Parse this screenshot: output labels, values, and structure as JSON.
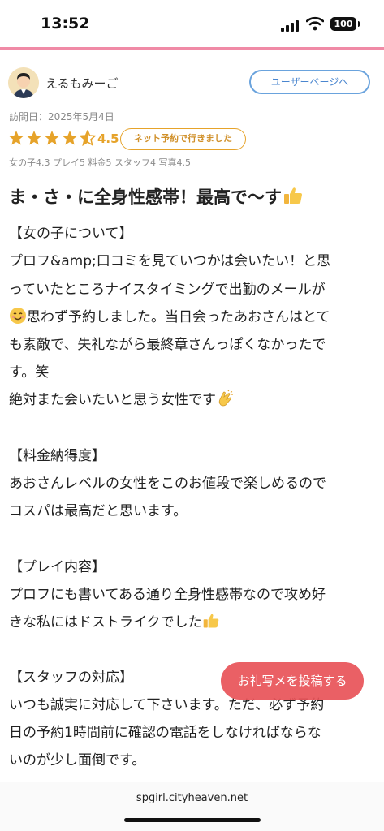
{
  "status": {
    "time": "13:52",
    "battery": "100"
  },
  "reviewer": {
    "name": "えるもみーご",
    "user_page_button": "ユーザーページへ"
  },
  "review": {
    "visit_date": "訪問日：2025年5月4日",
    "rating": "4.5",
    "rating_stars": 4.5,
    "badge": "ネット予約で行きました",
    "scores": "女の子4.3 プレイ5 料金5 スタッフ4 写真4.5",
    "title": "ま・さ・に全身性感帯！最高で〜す",
    "lines": [
      "【女の子について】",
      "プロフ&amp;口コミを見ていつかは会いたい！と思",
      "っていたところナイスタイミングで出勤のメールが",
      "思わず予約しました。当日会ったあおさんはとて",
      "も素敵で、失礼ながら最終章さんっぽくなかったで",
      "す。笑",
      "絶対また会いたいと思う女性です",
      "【料金納得度】",
      "あおさんレベルの女性をこのお値段で楽しめるので",
      "コスパは最高だと思います。",
      "【プレイ内容】",
      "プロフにも書いてある通り全身性感帯なので攻め好",
      "きな私にはドストライクでした",
      "【スタッフの対応】",
      "いつも誠実に対応して下さいます。ただ、必ず予約",
      "日の予約1時間前に確認の電話をしなければならな",
      "いのが少し面倒です。"
    ]
  },
  "toast": {
    "label": "お礼写メを投稿する"
  },
  "browser": {
    "url": "spgirl.cityheaven.net"
  }
}
